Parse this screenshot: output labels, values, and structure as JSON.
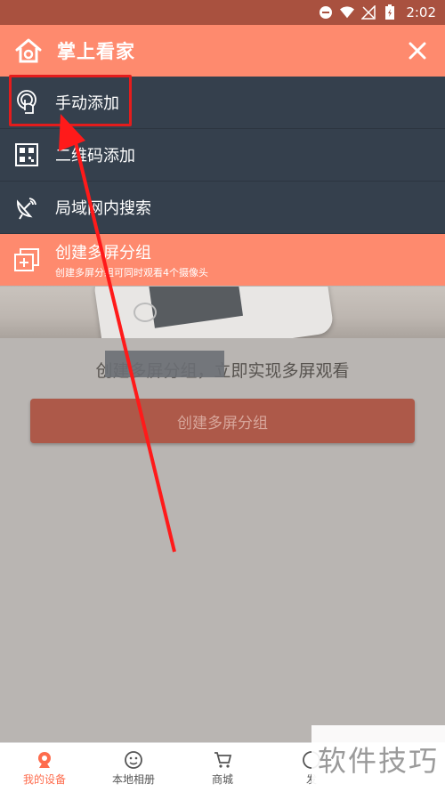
{
  "status_bar": {
    "time": "2:02"
  },
  "header": {
    "title": "掌上看家"
  },
  "menu": {
    "items": [
      {
        "label": "手动添加",
        "icon": "touch-icon"
      },
      {
        "label": "二维码添加",
        "icon": "qr-code-icon"
      },
      {
        "label": "局域网内搜索",
        "icon": "satellite-icon"
      }
    ],
    "group": {
      "title": "创建多屏分组",
      "subtitle": "创建多屏分组可同时观看4个摄像头"
    }
  },
  "main": {
    "tagline": "创建多屏分组，立即实现多屏观看",
    "create_button": "创建多屏分组"
  },
  "bottom_nav": [
    {
      "label": "我的设备",
      "icon": "camera-icon"
    },
    {
      "label": "本地相册",
      "icon": "album-icon"
    },
    {
      "label": "商城",
      "icon": "cart-icon"
    },
    {
      "label": "发",
      "icon": "discover-icon"
    }
  ],
  "watermark": "软件技巧",
  "colors": {
    "accent": "#fe8a6e",
    "menu_bg": "#35404d",
    "status": "#a9513f",
    "highlight": "#e41c1c"
  }
}
